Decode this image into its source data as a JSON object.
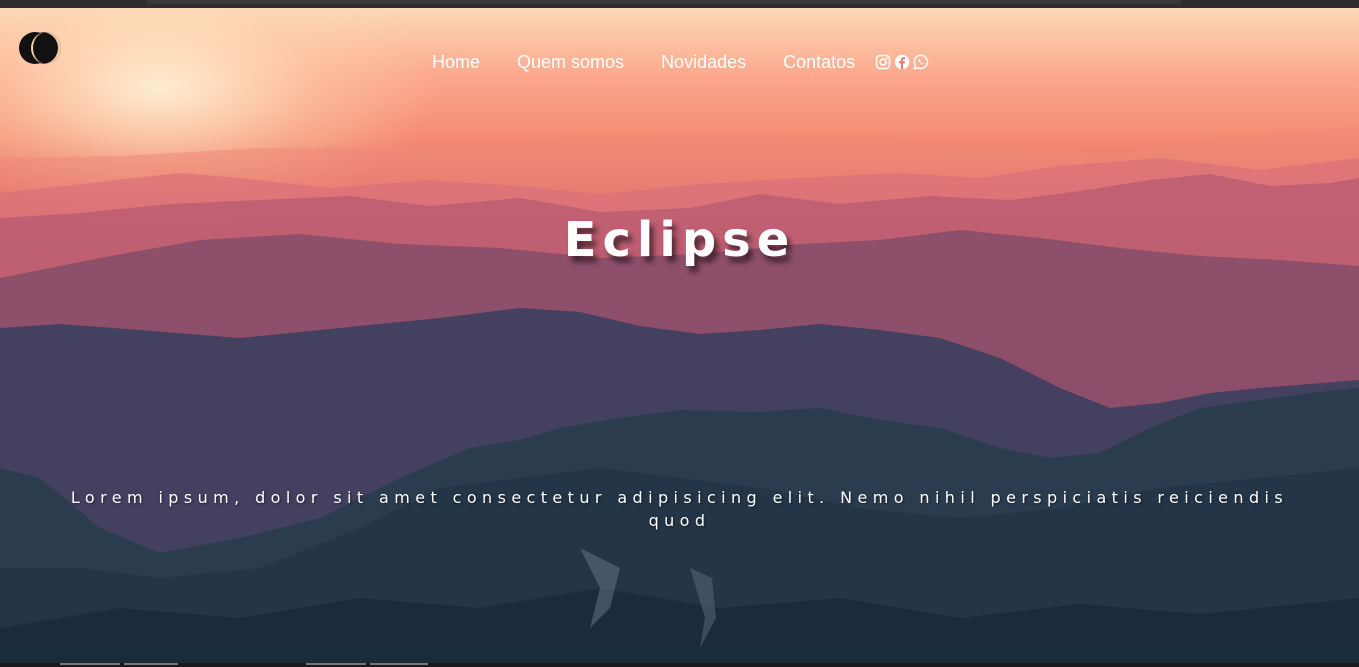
{
  "site": {
    "logo_icon": "eclipse-logo-icon"
  },
  "nav": {
    "items": [
      {
        "label": "Home"
      },
      {
        "label": "Quem somos"
      },
      {
        "label": "Novidades"
      },
      {
        "label": "Contatos"
      }
    ],
    "social_icons": [
      "instagram-icon",
      "facebook-icon",
      "whatsapp-icon"
    ]
  },
  "hero": {
    "title": "Eclipse",
    "text": "Lorem ipsum, dolor sit amet consectetur adipisicing elit. Nemo nihil perspiciatis reiciendis quod"
  },
  "colors": {
    "nav_text": "#ffffff",
    "sky_top": "#fbd9b6",
    "sky_mid": "#f48a72",
    "mountain_dark": "#1c2b3c"
  }
}
